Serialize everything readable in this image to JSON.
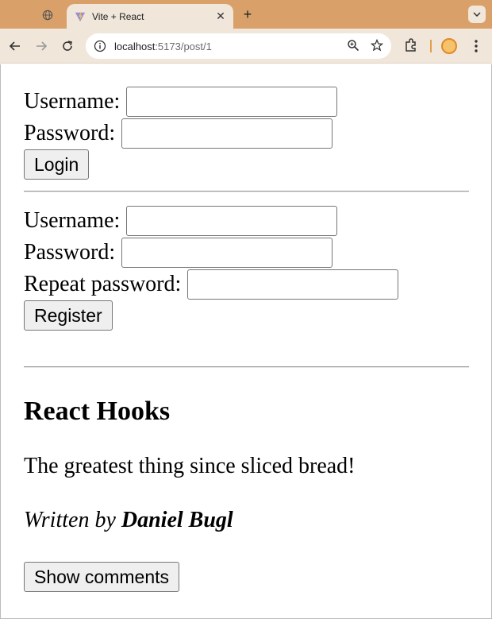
{
  "browser": {
    "tab_title": "Vite + React",
    "url_host": "localhost",
    "url_path": ":5173/post/1"
  },
  "login": {
    "username_label": "Username:",
    "password_label": "Password:",
    "button_label": "Login",
    "username_value": "",
    "password_value": ""
  },
  "register": {
    "username_label": "Username:",
    "password_label": "Password:",
    "repeat_label": "Repeat password:",
    "button_label": "Register",
    "username_value": "",
    "password_value": "",
    "repeat_value": ""
  },
  "post": {
    "title": "React Hooks",
    "content": "The greatest thing since sliced bread!",
    "written_by": "Written by ",
    "author": "Daniel Bugl",
    "comments_button": "Show comments"
  }
}
